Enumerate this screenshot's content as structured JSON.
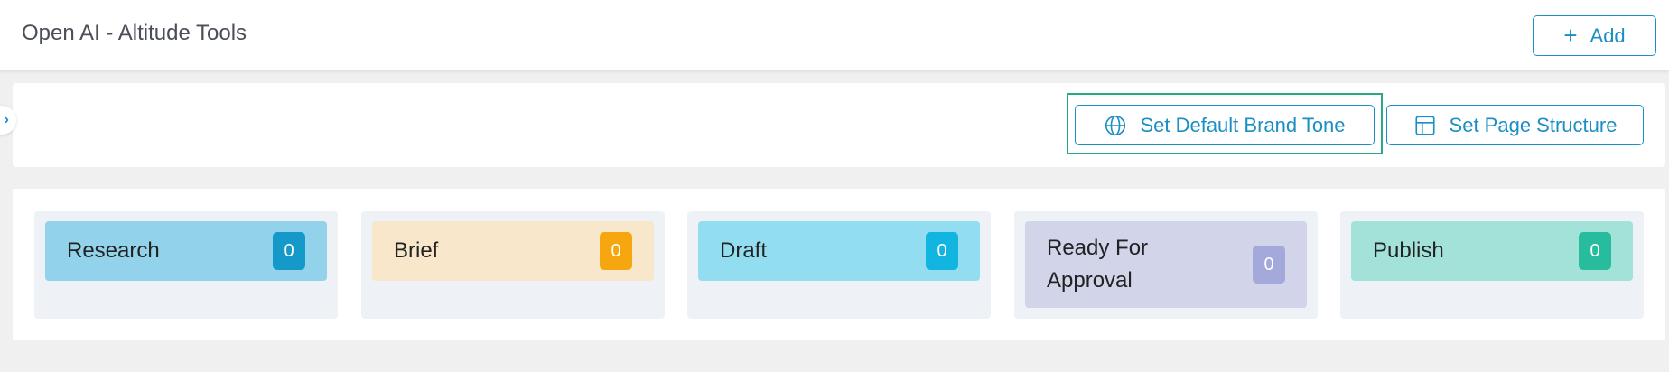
{
  "header": {
    "title": "Open AI - Altitude Tools",
    "add_label": "Add"
  },
  "toolbar": {
    "brand_tone_label": "Set Default Brand Tone",
    "page_structure_label": "Set Page Structure"
  },
  "columns": [
    {
      "title": "Research",
      "count": "0",
      "header_color": "#92d3eb",
      "badge_color": "#1599c8"
    },
    {
      "title": "Brief",
      "count": "0",
      "header_color": "#f8e7cb",
      "badge_color": "#f6a60f"
    },
    {
      "title": "Draft",
      "count": "0",
      "header_color": "#92def0",
      "badge_color": "#12b4e0"
    },
    {
      "title": "Ready For Approval",
      "count": "0",
      "header_color": "#d2d4ea",
      "badge_color": "#a4a9dc"
    },
    {
      "title": "Publish",
      "count": "0",
      "header_color": "#a2e2d8",
      "badge_color": "#28bc9f"
    }
  ],
  "colors": {
    "accent": "#1a8fc4",
    "focus_outline": "#28a883"
  },
  "icons": {
    "add": "plus-icon",
    "brand_tone": "globe-icon",
    "page_structure": "layout-icon",
    "sidebar_toggle": "chevron-right-icon"
  }
}
